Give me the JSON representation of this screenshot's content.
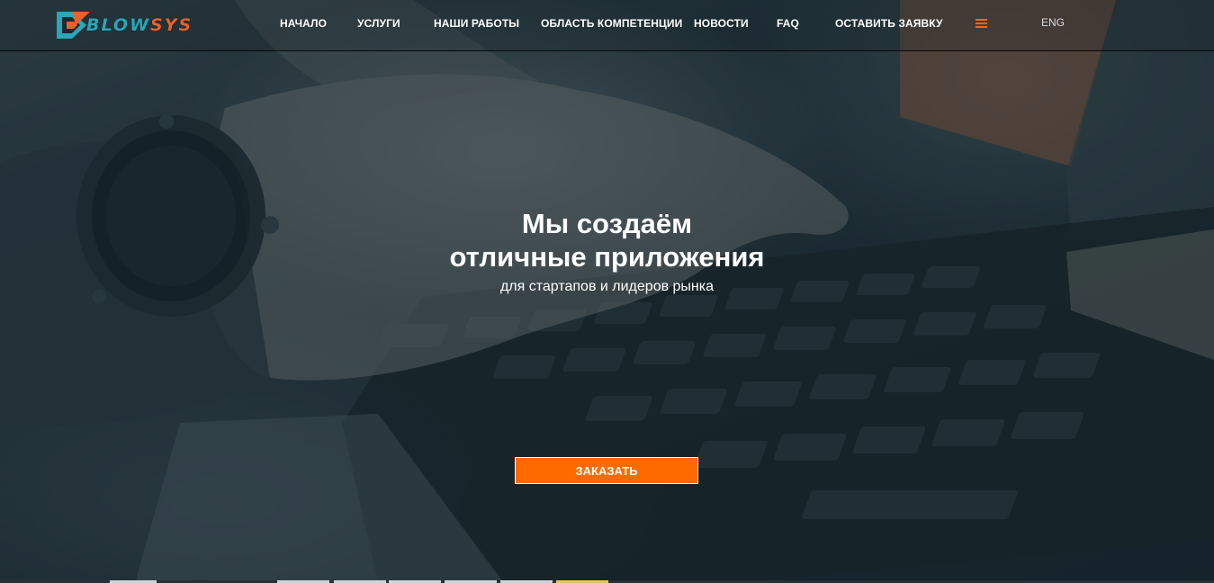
{
  "logo": {
    "text_prefix": "BLOW",
    "text_suffix": "SYS"
  },
  "nav": {
    "items": [
      {
        "label": "НАЧАЛО"
      },
      {
        "label": "УСЛУГИ"
      },
      {
        "label": "НАШИ РАБОТЫ"
      },
      {
        "label": "ОБЛАСТЬ КОМПЕТЕНЦИИ"
      },
      {
        "label": "НОВОСТИ"
      },
      {
        "label": "FAQ"
      },
      {
        "label": "ОСТАВИТЬ ЗАЯВКУ"
      }
    ],
    "menu_icon": "hamburger-icon",
    "lang_label": "ENG"
  },
  "hero": {
    "headline_line1": "Мы создаём",
    "headline_line2": "отличные приложения",
    "subheadline": "для стартапов и лидеров рынка",
    "cta_label": "ЗАКАЗАТЬ"
  },
  "colors": {
    "accent": "#ff6a00",
    "logo_orange": "#e8622a",
    "logo_teal": "#2aa7b9",
    "text": "#ffffff"
  }
}
